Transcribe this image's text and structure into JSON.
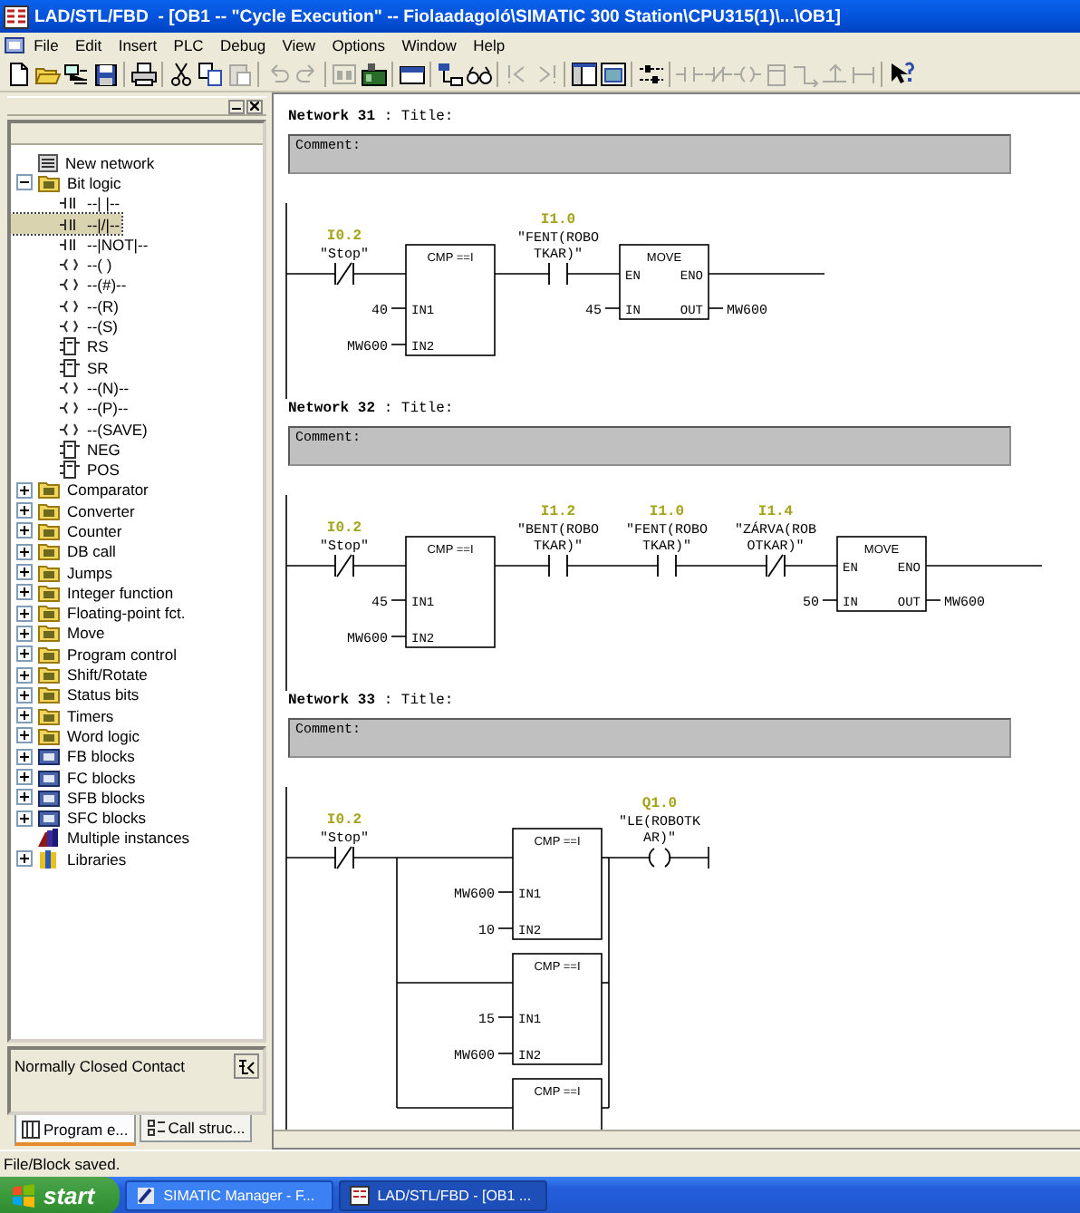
{
  "window": {
    "title": "LAD/STL/FBD  - [OB1 -- \"Cycle Execution\" -- Fiolaadagoló\\SIMATIC 300 Station\\CPU315(1)\\...\\OB1]"
  },
  "menu": [
    "File",
    "Edit",
    "Insert",
    "PLC",
    "Debug",
    "View",
    "Options",
    "Window",
    "Help"
  ],
  "toolbar": {
    "groups": [
      {
        "buttons": [
          {
            "kind": "new",
            "disabled": false
          },
          {
            "kind": "open",
            "disabled": false
          },
          {
            "kind": "nodes",
            "disabled": false
          },
          {
            "kind": "save",
            "disabled": false
          }
        ]
      },
      {
        "buttons": [
          {
            "kind": "print",
            "disabled": false
          }
        ]
      },
      {
        "buttons": [
          {
            "kind": "cut",
            "disabled": false
          },
          {
            "kind": "copy",
            "disabled": false
          },
          {
            "kind": "paste",
            "disabled": true
          }
        ]
      },
      {
        "buttons": [
          {
            "kind": "undo",
            "disabled": true
          },
          {
            "kind": "redo",
            "disabled": true
          }
        ]
      },
      {
        "buttons": [
          {
            "kind": "compare",
            "disabled": true
          },
          {
            "kind": "module",
            "disabled": false
          }
        ]
      },
      {
        "buttons": [
          {
            "kind": "window",
            "disabled": false
          }
        ]
      },
      {
        "buttons": [
          {
            "kind": "network",
            "disabled": false
          },
          {
            "kind": "glasses",
            "disabled": false
          }
        ]
      },
      {
        "buttons": [
          {
            "kind": "prev",
            "disabled": true
          },
          {
            "kind": "next",
            "disabled": true
          }
        ]
      },
      {
        "buttons": [
          {
            "kind": "overview",
            "disabled": false
          },
          {
            "kind": "details",
            "disabled": false
          }
        ]
      },
      {
        "buttons": [
          {
            "kind": "branch",
            "disabled": false
          }
        ]
      },
      {
        "buttons": [
          {
            "kind": "no-contact",
            "disabled": true
          },
          {
            "kind": "nc-contact",
            "disabled": true
          },
          {
            "kind": "coil",
            "disabled": true
          },
          {
            "kind": "box",
            "disabled": true
          },
          {
            "kind": "open-branch",
            "disabled": true
          },
          {
            "kind": "close-branch",
            "disabled": true
          },
          {
            "kind": "connect",
            "disabled": true
          }
        ]
      },
      {
        "buttons": [
          {
            "kind": "help",
            "disabled": false
          }
        ]
      }
    ]
  },
  "catalog": {
    "items": [
      {
        "kind": "network",
        "label": "New network",
        "selected": false
      },
      {
        "kind": "folder",
        "label": "Bit logic",
        "selected": false,
        "expanded": true,
        "children": [
          {
            "kind": "contact",
            "label": "--| |--",
            "selected": false
          },
          {
            "kind": "contact",
            "label": "--|/|--",
            "selected": true
          },
          {
            "kind": "contact",
            "label": "--|NOT|--",
            "selected": false
          },
          {
            "kind": "coil",
            "label": "--( )",
            "selected": false
          },
          {
            "kind": "coil",
            "label": "--(#)--",
            "selected": false
          },
          {
            "kind": "coil",
            "label": "--(R)",
            "selected": false
          },
          {
            "kind": "coil",
            "label": "--(S)",
            "selected": false
          },
          {
            "kind": "box",
            "label": "RS",
            "selected": false
          },
          {
            "kind": "box",
            "label": "SR",
            "selected": false
          },
          {
            "kind": "coil",
            "label": "--(N)--",
            "selected": false
          },
          {
            "kind": "coil",
            "label": "--(P)--",
            "selected": false
          },
          {
            "kind": "coil",
            "label": "--(SAVE)",
            "selected": false
          },
          {
            "kind": "box",
            "label": "NEG",
            "selected": false
          },
          {
            "kind": "box",
            "label": "POS",
            "selected": false
          }
        ]
      },
      {
        "kind": "folder",
        "label": "Comparator",
        "selected": false,
        "expanded": false
      },
      {
        "kind": "folder",
        "label": "Converter",
        "selected": false,
        "expanded": false
      },
      {
        "kind": "folder",
        "label": "Counter",
        "selected": false,
        "expanded": false
      },
      {
        "kind": "folder",
        "label": "DB call",
        "selected": false,
        "expanded": false
      },
      {
        "kind": "folder",
        "label": "Jumps",
        "selected": false,
        "expanded": false
      },
      {
        "kind": "folder",
        "label": "Integer function",
        "selected": false,
        "expanded": false
      },
      {
        "kind": "folder",
        "label": "Floating-point fct.",
        "selected": false,
        "expanded": false
      },
      {
        "kind": "folder",
        "label": "Move",
        "selected": false,
        "expanded": false
      },
      {
        "kind": "folder",
        "label": "Program control",
        "selected": false,
        "expanded": false
      },
      {
        "kind": "folder",
        "label": "Shift/Rotate",
        "selected": false,
        "expanded": false
      },
      {
        "kind": "folder",
        "label": "Status bits",
        "selected": false,
        "expanded": false
      },
      {
        "kind": "folder",
        "label": "Timers",
        "selected": false,
        "expanded": false
      },
      {
        "kind": "folder",
        "label": "Word logic",
        "selected": false,
        "expanded": false
      },
      {
        "kind": "block-folder",
        "label": "FB blocks",
        "selected": false,
        "expanded": false
      },
      {
        "kind": "block-folder",
        "label": "FC blocks",
        "selected": false,
        "expanded": false
      },
      {
        "kind": "block-folder",
        "label": "SFB blocks",
        "selected": false,
        "expanded": false
      },
      {
        "kind": "block-folder",
        "label": "SFC blocks",
        "selected": false,
        "expanded": false
      },
      {
        "kind": "instances",
        "label": "Multiple instances",
        "selected": false
      },
      {
        "kind": "library",
        "label": "Libraries",
        "selected": false,
        "expanded": false
      }
    ],
    "info": "Normally Closed Contact",
    "tabs": [
      {
        "label": "Program e...",
        "selected": true
      },
      {
        "label": "Call struc...",
        "selected": false
      }
    ]
  },
  "editor": {
    "networks": [
      {
        "heading": "**Network 31** : Title:",
        "comment": "Comment:",
        "rung": [
          {
            "kind": "nc-contact",
            "address": "I0.2",
            "symbol": [
              "\"Stop\""
            ]
          },
          {
            "kind": "box",
            "title": "CMP ==I",
            "inputs": [
              {
                "pin": "IN1",
                "operand": "40"
              },
              {
                "pin": "IN2",
                "operand": "MW600"
              }
            ]
          },
          {
            "kind": "no-contact",
            "address": "I1.0",
            "symbol": [
              "\"FENT(ROBO",
              "TKAR)\""
            ]
          },
          {
            "kind": "box",
            "title": "MOVE",
            "enable": "EN",
            "enable_out": "ENO",
            "inputs": [
              {
                "pin": "IN",
                "operand": "45"
              }
            ],
            "outputs": [
              {
                "pin": "OUT",
                "operand": "MW600"
              }
            ]
          }
        ]
      },
      {
        "heading": "**Network 32** : Title:",
        "comment": "Comment:",
        "rung": [
          {
            "kind": "nc-contact",
            "address": "I0.2",
            "symbol": [
              "\"Stop\""
            ]
          },
          {
            "kind": "box",
            "title": "CMP ==I",
            "inputs": [
              {
                "pin": "IN1",
                "operand": "45"
              },
              {
                "pin": "IN2",
                "operand": "MW600"
              }
            ]
          },
          {
            "kind": "no-contact",
            "address": "I1.2",
            "symbol": [
              "\"BENT(ROBO",
              "TKAR)\""
            ]
          },
          {
            "kind": "no-contact",
            "address": "I1.0",
            "symbol": [
              "\"FENT(ROBO",
              "TKAR)\""
            ]
          },
          {
            "kind": "nc-contact",
            "address": "I1.4",
            "symbol": [
              "\"ZÁRVA(ROB",
              "OTKAR)\""
            ]
          },
          {
            "kind": "box",
            "title": "MOVE",
            "enable": "EN",
            "enable_out": "ENO",
            "inputs": [
              {
                "pin": "IN",
                "operand": "50"
              }
            ],
            "outputs": [
              {
                "pin": "OUT",
                "operand": "MW600"
              }
            ]
          }
        ]
      },
      {
        "heading": "**Network 33** : Title:",
        "comment": "Comment:",
        "rung": [
          {
            "kind": "nc-contact",
            "address": "I0.2",
            "symbol": [
              "\"Stop\""
            ]
          },
          {
            "kind": "parallel",
            "branches": [
              {
                "kind": "box",
                "title": "CMP ==I",
                "inputs": [
                  {
                    "pin": "IN1",
                    "operand": "MW600"
                  },
                  {
                    "pin": "IN2",
                    "operand": "10"
                  }
                ]
              },
              {
                "kind": "box",
                "title": "CMP ==I",
                "inputs": [
                  {
                    "pin": "IN1",
                    "operand": "15"
                  },
                  {
                    "pin": "IN2",
                    "operand": "MW600"
                  }
                ]
              },
              {
                "kind": "box",
                "title": "CMP ==I"
              }
            ]
          },
          {
            "kind": "coil",
            "address": "Q1.0",
            "symbol": [
              "\"LE(ROBOTK",
              "AR)\""
            ]
          }
        ]
      }
    ]
  },
  "status_bar": "File/Block saved.",
  "taskbar": {
    "start": "start",
    "tasks": [
      {
        "label": "SIMATIC Manager - F...",
        "selected": false
      },
      {
        "label": "LAD/STL/FBD - [OB1 ...",
        "selected": true
      }
    ]
  }
}
